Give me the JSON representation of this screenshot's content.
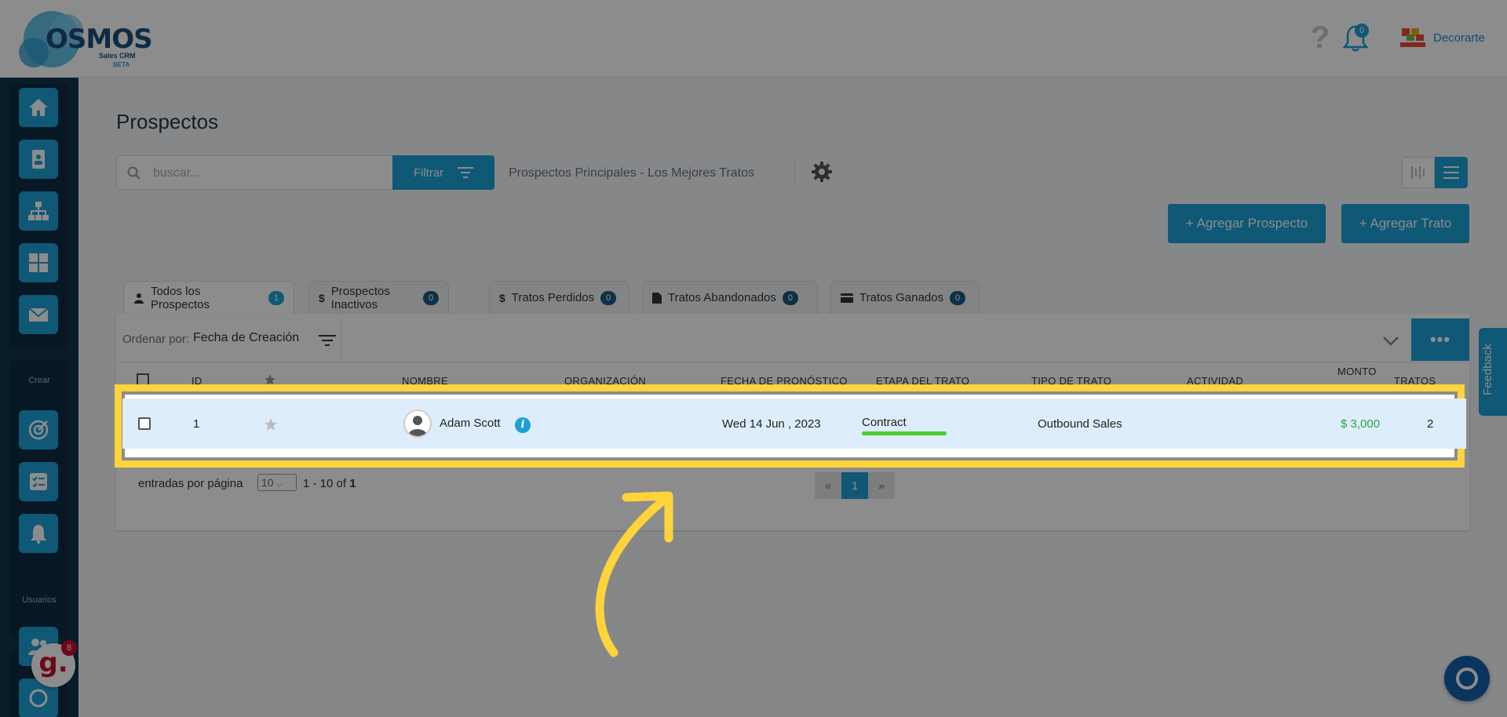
{
  "header": {
    "logo_text_1": "O",
    "logo_text_2": "SMOS",
    "logo_sub": "Sales CRM",
    "logo_beta": "BETA",
    "notification_count": "0",
    "company_name": "Decorarte"
  },
  "sidebar": {
    "section_create": "Crear",
    "section_users": "Usuarios"
  },
  "page": {
    "title": "Prospectos",
    "search_placeholder": "buscar...",
    "filter_label": "Filtrar",
    "view_name": "Prospectos Principales - Los Mejores Tratos",
    "add_prospect": "+ Agregar Prospecto",
    "add_deal": "+ Agregar Trato"
  },
  "tabs": [
    {
      "label": "Todos los Prospectos",
      "count": "1",
      "icon": "user-icon"
    },
    {
      "label": "Prospectos Inactivos",
      "count": "0",
      "icon": "dollar-icon"
    },
    {
      "label": "Tratos Perdidos",
      "count": "0",
      "icon": "dollar-icon"
    },
    {
      "label": "Tratos Abandonados",
      "count": "0",
      "icon": "file-icon"
    },
    {
      "label": "Tratos Ganados",
      "count": "0",
      "icon": "card-icon"
    }
  ],
  "order": {
    "label": "Ordenar por:",
    "value": "Fecha de Creación"
  },
  "table": {
    "columns": {
      "id": "ID",
      "name": "NOMBRE",
      "org": "ORGANIZACIÓN",
      "forecast": "FECHA DE PRONÓSTICO",
      "stage": "ETAPA DEL TRATO",
      "type": "TIPO DE TRATO",
      "activity": "ACTIVIDAD",
      "amount": "MONTO",
      "deals": "TRATOS"
    },
    "rows": [
      {
        "id": "1",
        "name": "Adam Scott",
        "org": "",
        "forecast": "Wed 14 Jun , 2023",
        "stage": "Contract",
        "type": "Outbound Sales",
        "activity": "",
        "amount": "$ 3,000",
        "deals": "2"
      }
    ]
  },
  "pagination": {
    "per_page_label": "entradas por página",
    "per_page_value": "10",
    "range_prefix": "1 - 10 of ",
    "range_total": "1",
    "prev": "«",
    "current": "1",
    "next": "»"
  },
  "feedback_label": "Feedback",
  "widget_g": "g.",
  "widget_g_badge": "8",
  "colors": {
    "accent": "#1ca1d7",
    "sidebar": "#12344d",
    "highlight": "#ffd43b",
    "amount": "#28a745",
    "stage_bar": "#4ccd2a"
  }
}
